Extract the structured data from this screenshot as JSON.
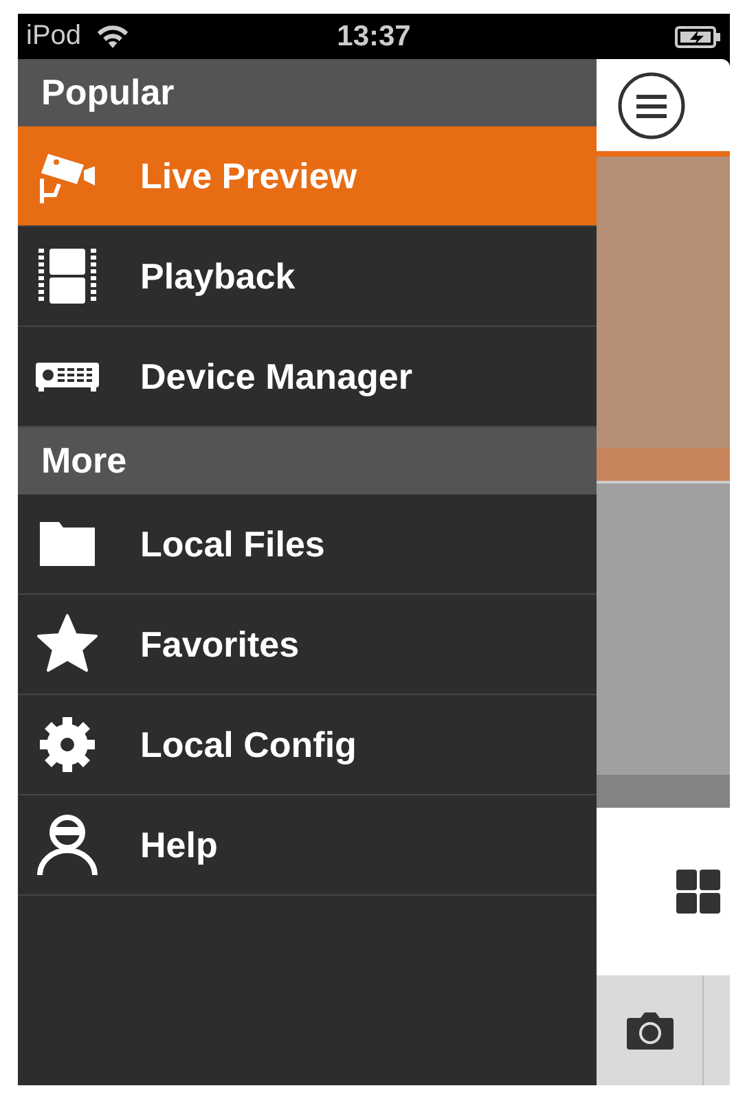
{
  "status_bar": {
    "carrier": "iPod",
    "time": "13:37"
  },
  "menu": {
    "sections": [
      {
        "title": "Popular",
        "items": [
          {
            "label": "Live Preview",
            "selected": true
          },
          {
            "label": "Playback",
            "selected": false
          },
          {
            "label": "Device Manager",
            "selected": false
          }
        ]
      },
      {
        "title": "More",
        "items": [
          {
            "label": "Local Files",
            "selected": false
          },
          {
            "label": "Favorites",
            "selected": false
          },
          {
            "label": "Local Config",
            "selected": false
          },
          {
            "label": "Help",
            "selected": false
          }
        ]
      }
    ]
  }
}
